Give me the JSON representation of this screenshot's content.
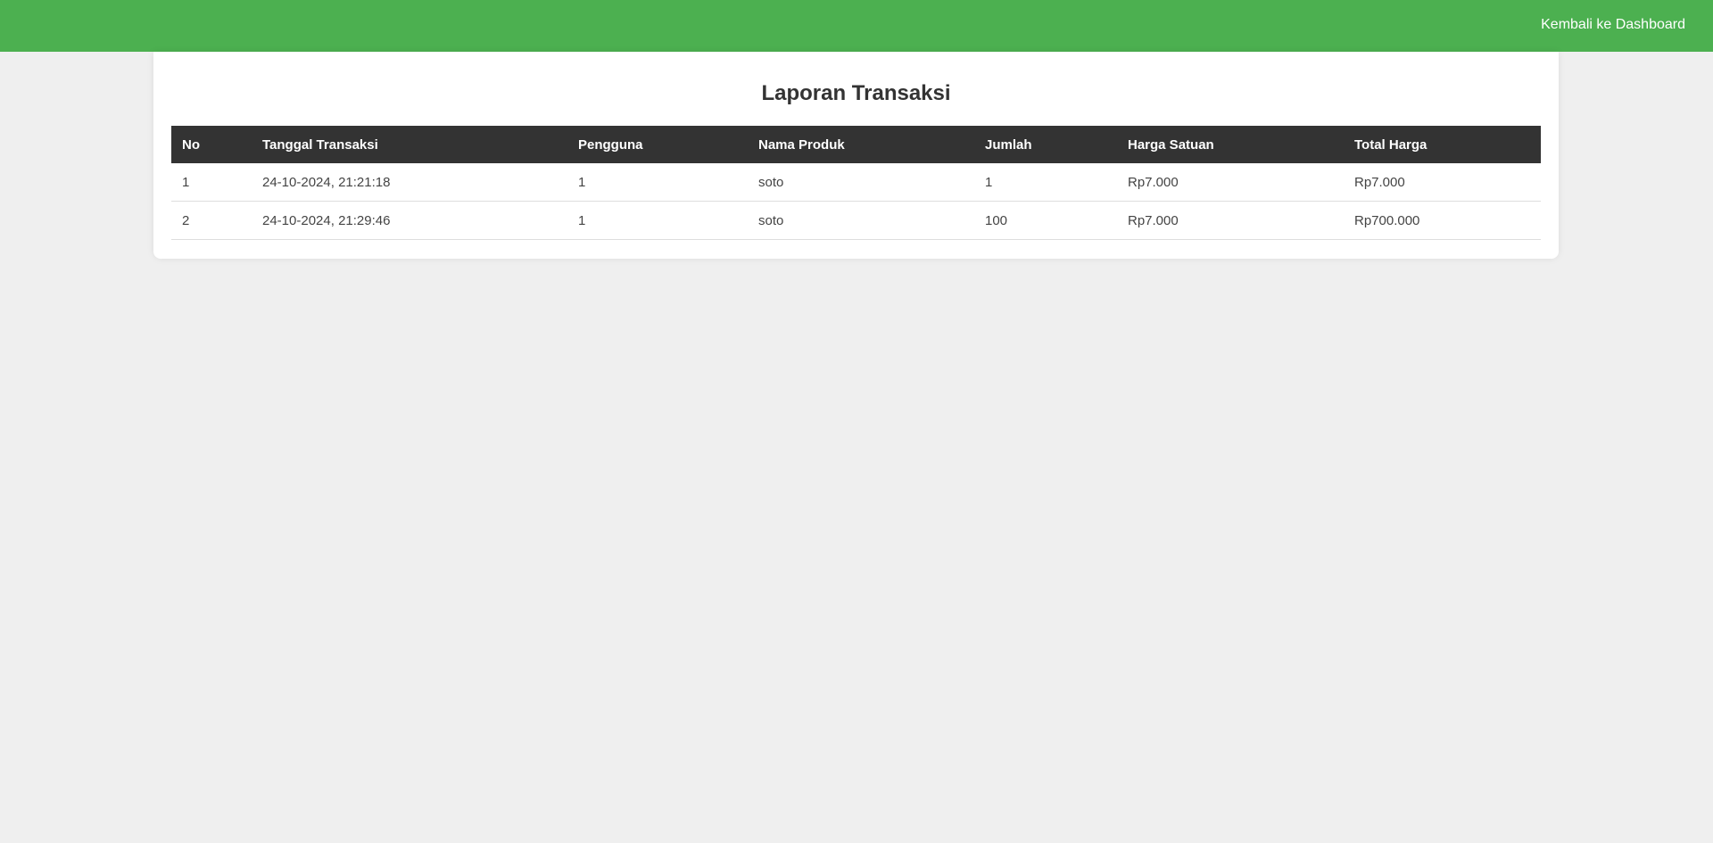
{
  "header": {
    "back_link_label": "Kembali ke Dashboard",
    "accent_color": "#4cb050"
  },
  "report": {
    "title": "Laporan Transaksi",
    "columns": [
      "No",
      "Tanggal Transaksi",
      "Pengguna",
      "Nama Produk",
      "Jumlah",
      "Harga Satuan",
      "Total Harga"
    ],
    "rows": [
      {
        "no": "1",
        "date": "24-10-2024, 21:21:18",
        "user": "1",
        "product": "soto",
        "qty": "1",
        "unit_price": "Rp7.000",
        "total": "Rp7.000"
      },
      {
        "no": "2",
        "date": "24-10-2024, 21:29:46",
        "user": "1",
        "product": "soto",
        "qty": "100",
        "unit_price": "Rp7.000",
        "total": "Rp700.000"
      }
    ]
  }
}
